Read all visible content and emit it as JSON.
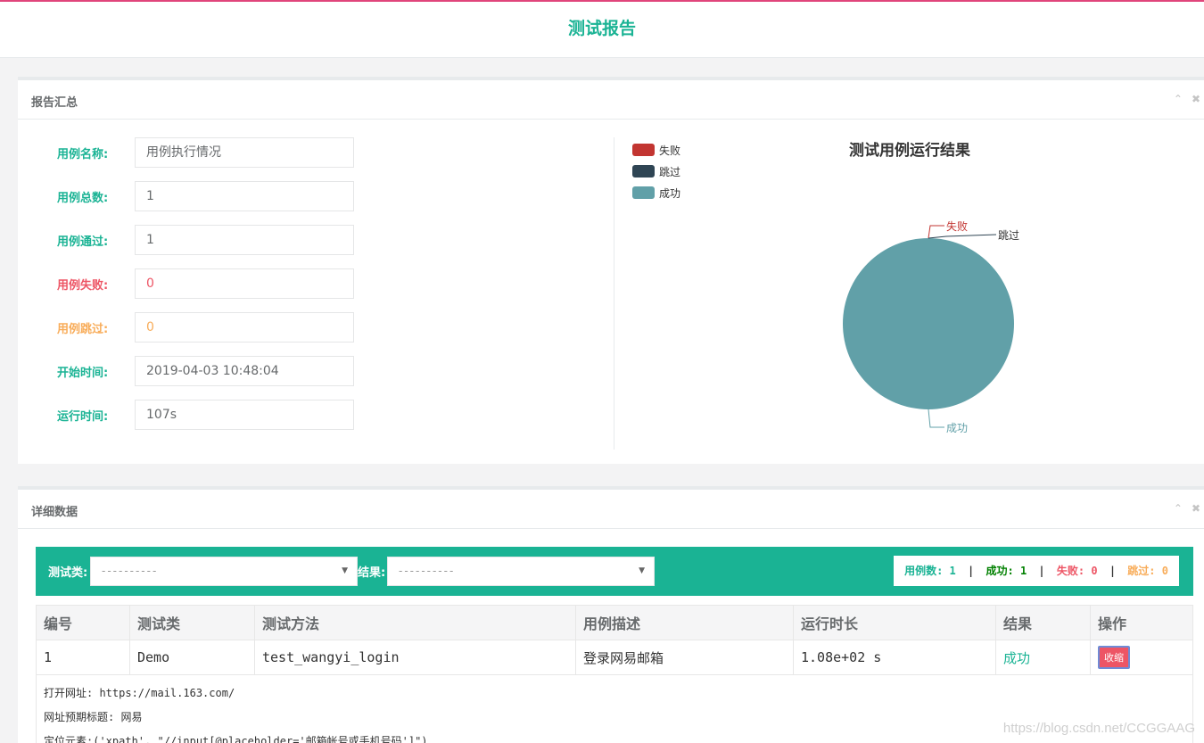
{
  "header": {
    "title": "测试报告"
  },
  "summary_panel": {
    "title": "报告汇总",
    "fields": [
      {
        "label": "用例名称:",
        "value": "用例执行情况"
      },
      {
        "label": "用例总数:",
        "value": "1"
      },
      {
        "label": "用例通过:",
        "value": "1"
      },
      {
        "label": "用例失败:",
        "value": "0"
      },
      {
        "label": "用例跳过:",
        "value": "0"
      },
      {
        "label": "开始时间:",
        "value": "2019-04-03 10:48:04"
      },
      {
        "label": "运行时间:",
        "value": "107s"
      }
    ]
  },
  "chart_data": {
    "type": "pie",
    "title": "测试用例运行结果",
    "legend_position": "top-left",
    "categories": [
      "失败",
      "跳过",
      "成功"
    ],
    "values": [
      0,
      0,
      1
    ],
    "colors": [
      "#c23531",
      "#2f4554",
      "#61a0a8"
    ]
  },
  "detail_panel": {
    "title": "详细数据",
    "filter": {
      "class_label": "测试类:",
      "class_value": "----------",
      "result_label": "结果:",
      "result_value": "----------"
    },
    "stats": {
      "total_label": "用例数:",
      "total": "1",
      "pass_label": "成功:",
      "pass": "1",
      "fail_label": "失败:",
      "fail": "0",
      "skip_label": "跳过:",
      "skip": "0",
      "sep": "|"
    },
    "columns": [
      "编号",
      "测试类",
      "测试方法",
      "用例描述",
      "运行时长",
      "结果",
      "操作"
    ],
    "row": {
      "id": "1",
      "class": "Demo",
      "method": "test_wangyi_login",
      "desc": "登录网易邮箱",
      "duration": "1.08e+02 s",
      "result": "成功",
      "action": "收缩"
    },
    "logs": [
      "打开网址: https://mail.163.com/",
      "网址预期标题: 网易",
      "定位元素:('xpath', \"//input[@placeholder='邮箱帐号或手机号码']\")"
    ]
  },
  "watermark": "https://blog.csdn.net/CCGGAAG",
  "icons": {
    "collapse": "chevron-up-icon",
    "close": "close-icon",
    "dropdown": "caret-down-icon"
  }
}
